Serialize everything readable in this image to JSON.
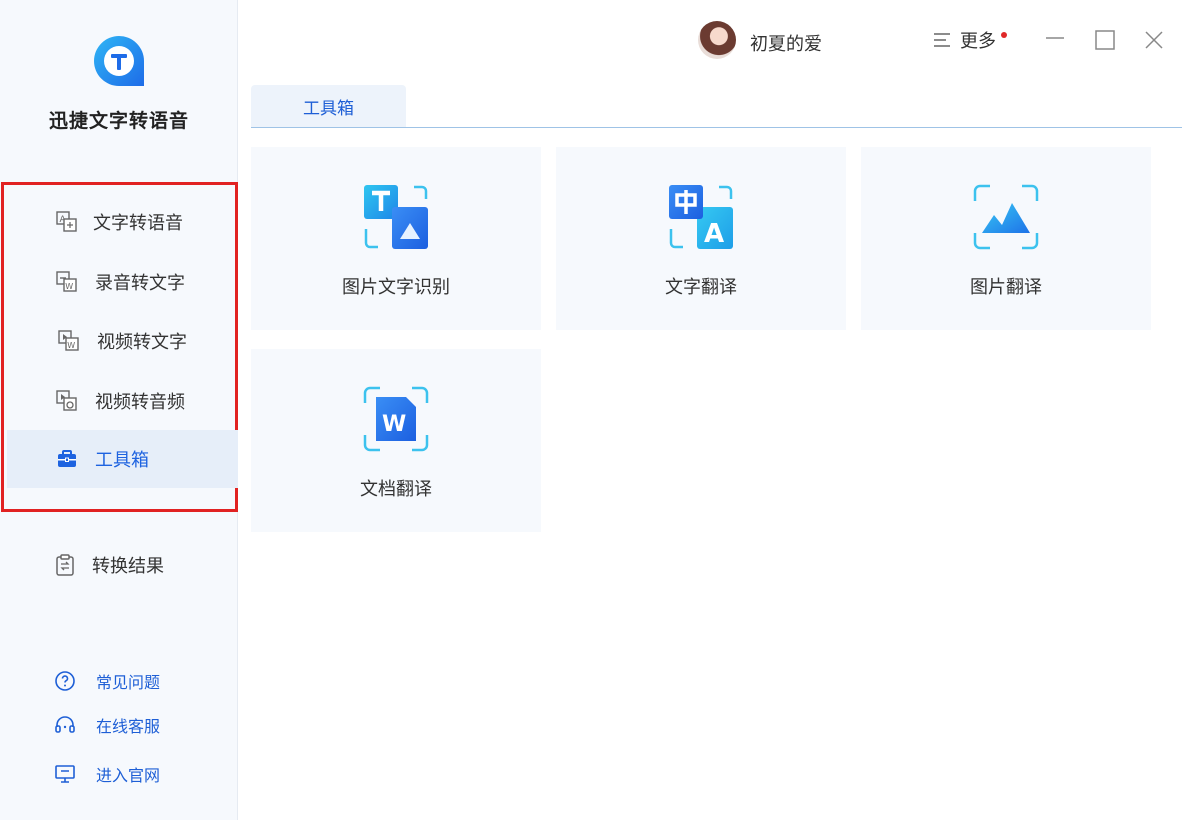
{
  "app": {
    "name": "迅捷文字转语音"
  },
  "sidebar": {
    "items": [
      {
        "label": "文字转语音",
        "icon": "text-to-speech-icon"
      },
      {
        "label": "录音转文字",
        "icon": "audio-to-text-icon"
      },
      {
        "label": "视频转文字",
        "icon": "video-to-text-icon"
      },
      {
        "label": "视频转音频",
        "icon": "video-to-audio-icon"
      },
      {
        "label": "工具箱",
        "icon": "toolbox-icon",
        "active": true
      }
    ],
    "result": {
      "label": "转换结果",
      "icon": "clipboard-icon"
    },
    "links": [
      {
        "label": "常见问题",
        "icon": "question-icon"
      },
      {
        "label": "在线客服",
        "icon": "headset-icon"
      },
      {
        "label": "进入官网",
        "icon": "monitor-icon"
      }
    ]
  },
  "header": {
    "username": "初夏的爱",
    "more_label": "更多"
  },
  "tabs": [
    {
      "label": "工具箱",
      "active": true
    }
  ],
  "tools": [
    {
      "label": "图片文字识别",
      "icon": "image-ocr-icon"
    },
    {
      "label": "文字翻译",
      "icon": "text-translate-icon"
    },
    {
      "label": "图片翻译",
      "icon": "image-translate-icon"
    },
    {
      "label": "文档翻译",
      "icon": "doc-translate-icon"
    }
  ],
  "colors": {
    "accent": "#1e63e0",
    "highlight_box": "#e12222",
    "sidebar_bg": "#f6f9fd"
  }
}
